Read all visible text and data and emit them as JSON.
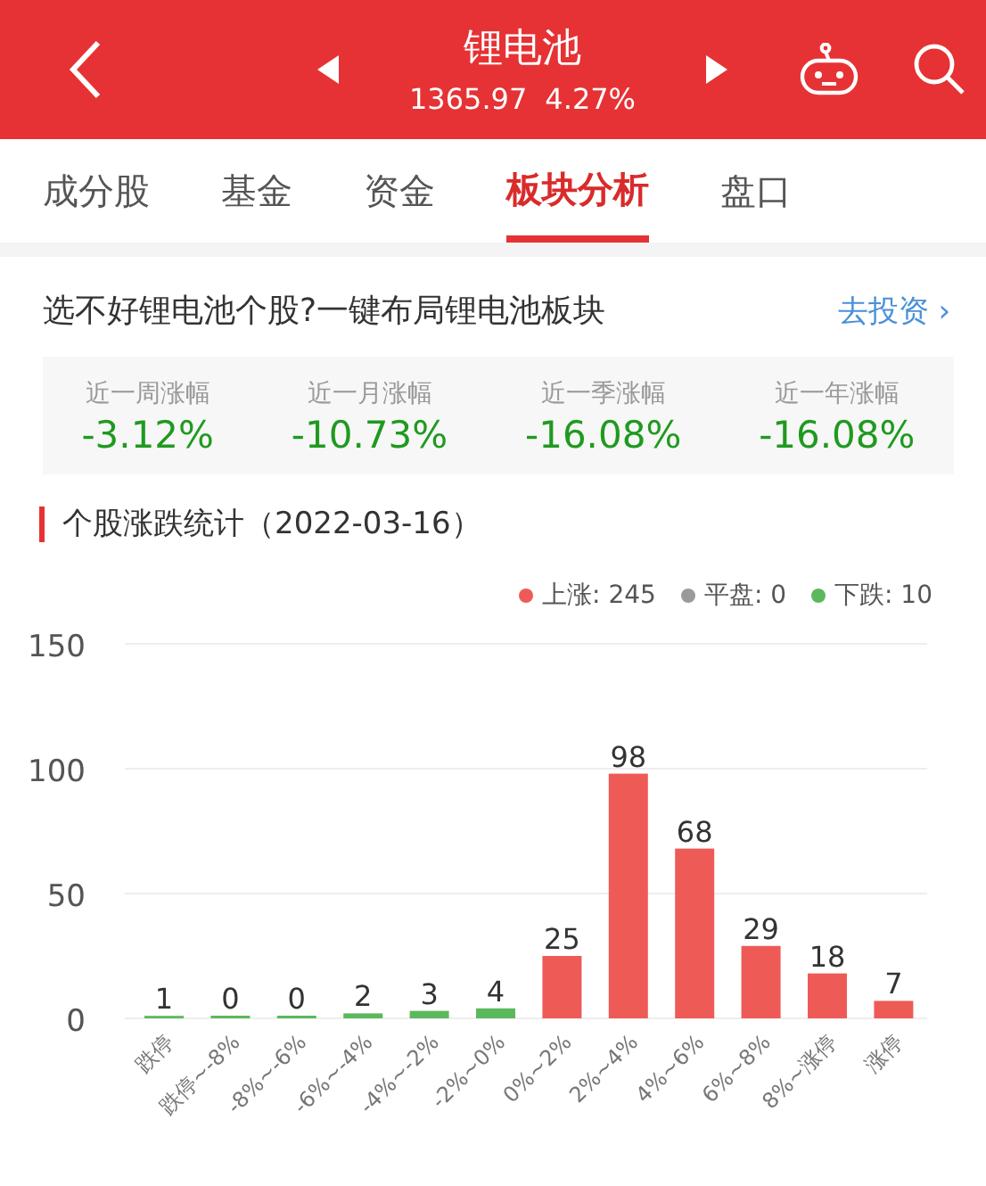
{
  "header": {
    "title": "锂电池",
    "price": "1365.97",
    "change": "4.27%"
  },
  "tabs": [
    {
      "label": "成分股",
      "selected": false
    },
    {
      "label": "基金",
      "selected": false
    },
    {
      "label": "资金",
      "selected": false
    },
    {
      "label": "板块分析",
      "selected": true
    },
    {
      "label": "盘口",
      "selected": false
    }
  ],
  "promo": {
    "text": "选不好锂电池个股?一键布局锂电池板块",
    "link": "去投资",
    "arrow": "›"
  },
  "stats": [
    {
      "label": "近一周涨幅",
      "value": "-3.12%"
    },
    {
      "label": "近一月涨幅",
      "value": "-10.73%"
    },
    {
      "label": "近一季涨幅",
      "value": "-16.08%"
    },
    {
      "label": "近一年涨幅",
      "value": "-16.08%"
    }
  ],
  "section_title": "个股涨跌统计（2022-03-16）",
  "legend": [
    {
      "label": "上涨: 245",
      "color": "#ee5b57"
    },
    {
      "label": "平盘: 0",
      "color": "#9a9a9a"
    },
    {
      "label": "下跌: 10",
      "color": "#5cb85c"
    }
  ],
  "chart_data": {
    "type": "bar",
    "categories": [
      "跌停",
      "跌停~-8%",
      "-8%~-6%",
      "-6%~-4%",
      "-4%~-2%",
      "-2%~0%",
      "0%~2%",
      "2%~4%",
      "4%~6%",
      "6%~8%",
      "8%~涨停",
      "涨停"
    ],
    "series": [
      {
        "color": "#5cb85c",
        "values": [
          1,
          0,
          0,
          2,
          3,
          4,
          null,
          null,
          null,
          null,
          null,
          null
        ]
      },
      {
        "color": "#ee5b57",
        "values": [
          null,
          null,
          null,
          null,
          null,
          null,
          25,
          98,
          68,
          29,
          18,
          7
        ]
      }
    ],
    "ylim": [
      0,
      150
    ],
    "yticks": [
      0,
      50,
      100,
      150
    ],
    "data_labels": true
  }
}
